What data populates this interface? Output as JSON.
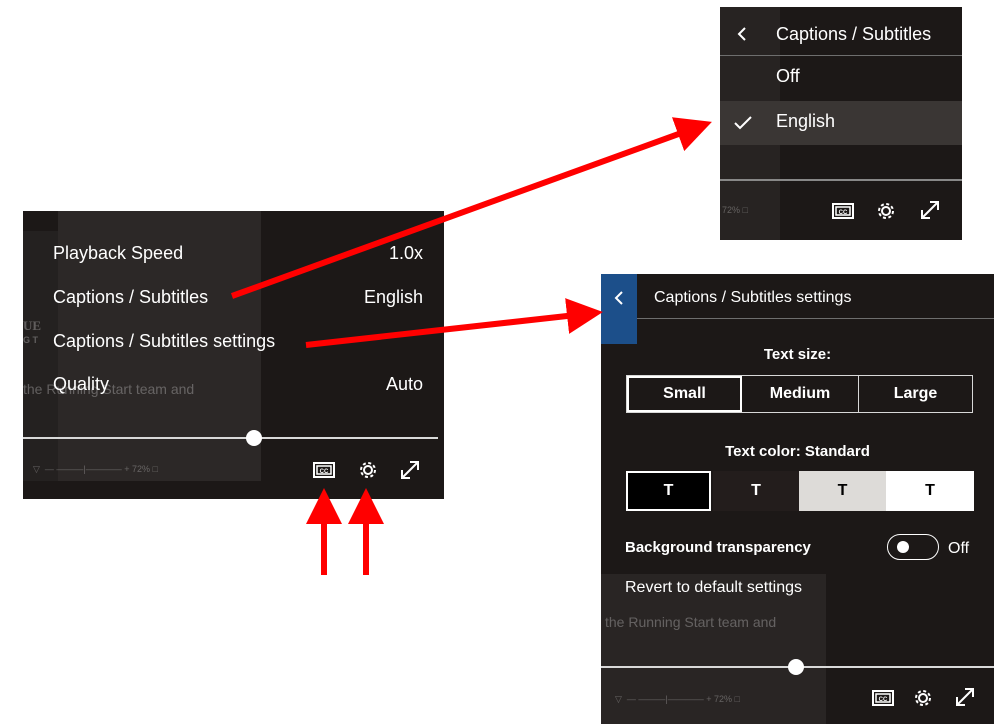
{
  "menu": {
    "items": [
      {
        "label": "Playback Speed",
        "value": "1.0x"
      },
      {
        "label": "Captions / Subtitles",
        "value": "English"
      },
      {
        "label": "Captions / Subtitles settings",
        "value": ""
      },
      {
        "label": "Quality",
        "value": "Auto"
      }
    ]
  },
  "captions_menu": {
    "title": "Captions / Subtitles",
    "options": [
      "Off",
      "English"
    ],
    "selected": "English"
  },
  "settings_panel": {
    "title": "Captions / Subtitles settings",
    "text_size_label": "Text size:",
    "sizes": [
      "Small",
      "Medium",
      "Large"
    ],
    "selected_size": "Small",
    "text_color_label": "Text color: Standard",
    "color_swatch_glyph": "T",
    "swatches": [
      {
        "bg": "#000000",
        "fg": "#ffffff"
      },
      {
        "bg": "#231d1c",
        "fg": "#ffffff"
      },
      {
        "bg": "#dddbd8",
        "fg": "#000000"
      },
      {
        "bg": "#ffffff",
        "fg": "#000000"
      }
    ],
    "bg_transparency_label": "Background transparency",
    "toggle_state": "Off",
    "revert_label": "Revert to default settings"
  },
  "background_video": {
    "caption_text_1": "the Running Start team and",
    "caption_text_2": "the Running Start team and",
    "volume_percent": "72%",
    "logo_fragment": "UE",
    "logo_fragment_2": "G T"
  },
  "icons": {
    "captions": "closed-captions-icon",
    "settings": "gear-icon",
    "fullscreen": "fullscreen-icon",
    "back": "chevron-left-icon",
    "check": "checkmark-icon"
  },
  "colors": {
    "arrow": "#ff0000",
    "panel_bg": "#1c1817",
    "accent_blue": "#1c4f8a"
  }
}
